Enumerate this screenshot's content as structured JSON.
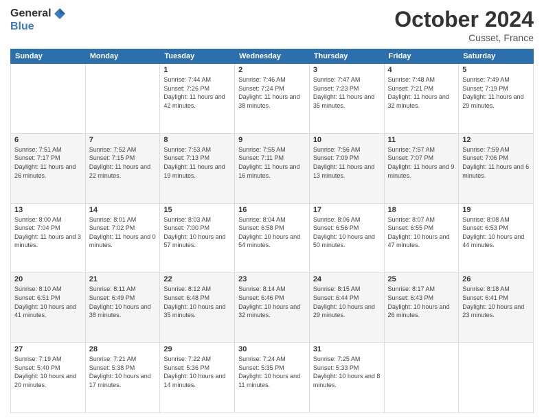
{
  "header": {
    "logo": {
      "general": "General",
      "blue": "Blue"
    },
    "month_year": "October 2024",
    "location": "Cusset, France"
  },
  "days_of_week": [
    "Sunday",
    "Monday",
    "Tuesday",
    "Wednesday",
    "Thursday",
    "Friday",
    "Saturday"
  ],
  "weeks": [
    [
      {
        "day": "",
        "info": ""
      },
      {
        "day": "",
        "info": ""
      },
      {
        "day": "1",
        "info": "Sunrise: 7:44 AM\nSunset: 7:26 PM\nDaylight: 11 hours and 42 minutes."
      },
      {
        "day": "2",
        "info": "Sunrise: 7:46 AM\nSunset: 7:24 PM\nDaylight: 11 hours and 38 minutes."
      },
      {
        "day": "3",
        "info": "Sunrise: 7:47 AM\nSunset: 7:23 PM\nDaylight: 11 hours and 35 minutes."
      },
      {
        "day": "4",
        "info": "Sunrise: 7:48 AM\nSunset: 7:21 PM\nDaylight: 11 hours and 32 minutes."
      },
      {
        "day": "5",
        "info": "Sunrise: 7:49 AM\nSunset: 7:19 PM\nDaylight: 11 hours and 29 minutes."
      }
    ],
    [
      {
        "day": "6",
        "info": "Sunrise: 7:51 AM\nSunset: 7:17 PM\nDaylight: 11 hours and 26 minutes."
      },
      {
        "day": "7",
        "info": "Sunrise: 7:52 AM\nSunset: 7:15 PM\nDaylight: 11 hours and 22 minutes."
      },
      {
        "day": "8",
        "info": "Sunrise: 7:53 AM\nSunset: 7:13 PM\nDaylight: 11 hours and 19 minutes."
      },
      {
        "day": "9",
        "info": "Sunrise: 7:55 AM\nSunset: 7:11 PM\nDaylight: 11 hours and 16 minutes."
      },
      {
        "day": "10",
        "info": "Sunrise: 7:56 AM\nSunset: 7:09 PM\nDaylight: 11 hours and 13 minutes."
      },
      {
        "day": "11",
        "info": "Sunrise: 7:57 AM\nSunset: 7:07 PM\nDaylight: 11 hours and 9 minutes."
      },
      {
        "day": "12",
        "info": "Sunrise: 7:59 AM\nSunset: 7:06 PM\nDaylight: 11 hours and 6 minutes."
      }
    ],
    [
      {
        "day": "13",
        "info": "Sunrise: 8:00 AM\nSunset: 7:04 PM\nDaylight: 11 hours and 3 minutes."
      },
      {
        "day": "14",
        "info": "Sunrise: 8:01 AM\nSunset: 7:02 PM\nDaylight: 11 hours and 0 minutes."
      },
      {
        "day": "15",
        "info": "Sunrise: 8:03 AM\nSunset: 7:00 PM\nDaylight: 10 hours and 57 minutes."
      },
      {
        "day": "16",
        "info": "Sunrise: 8:04 AM\nSunset: 6:58 PM\nDaylight: 10 hours and 54 minutes."
      },
      {
        "day": "17",
        "info": "Sunrise: 8:06 AM\nSunset: 6:56 PM\nDaylight: 10 hours and 50 minutes."
      },
      {
        "day": "18",
        "info": "Sunrise: 8:07 AM\nSunset: 6:55 PM\nDaylight: 10 hours and 47 minutes."
      },
      {
        "day": "19",
        "info": "Sunrise: 8:08 AM\nSunset: 6:53 PM\nDaylight: 10 hours and 44 minutes."
      }
    ],
    [
      {
        "day": "20",
        "info": "Sunrise: 8:10 AM\nSunset: 6:51 PM\nDaylight: 10 hours and 41 minutes."
      },
      {
        "day": "21",
        "info": "Sunrise: 8:11 AM\nSunset: 6:49 PM\nDaylight: 10 hours and 38 minutes."
      },
      {
        "day": "22",
        "info": "Sunrise: 8:12 AM\nSunset: 6:48 PM\nDaylight: 10 hours and 35 minutes."
      },
      {
        "day": "23",
        "info": "Sunrise: 8:14 AM\nSunset: 6:46 PM\nDaylight: 10 hours and 32 minutes."
      },
      {
        "day": "24",
        "info": "Sunrise: 8:15 AM\nSunset: 6:44 PM\nDaylight: 10 hours and 29 minutes."
      },
      {
        "day": "25",
        "info": "Sunrise: 8:17 AM\nSunset: 6:43 PM\nDaylight: 10 hours and 26 minutes."
      },
      {
        "day": "26",
        "info": "Sunrise: 8:18 AM\nSunset: 6:41 PM\nDaylight: 10 hours and 23 minutes."
      }
    ],
    [
      {
        "day": "27",
        "info": "Sunrise: 7:19 AM\nSunset: 5:40 PM\nDaylight: 10 hours and 20 minutes."
      },
      {
        "day": "28",
        "info": "Sunrise: 7:21 AM\nSunset: 5:38 PM\nDaylight: 10 hours and 17 minutes."
      },
      {
        "day": "29",
        "info": "Sunrise: 7:22 AM\nSunset: 5:36 PM\nDaylight: 10 hours and 14 minutes."
      },
      {
        "day": "30",
        "info": "Sunrise: 7:24 AM\nSunset: 5:35 PM\nDaylight: 10 hours and 11 minutes."
      },
      {
        "day": "31",
        "info": "Sunrise: 7:25 AM\nSunset: 5:33 PM\nDaylight: 10 hours and 8 minutes."
      },
      {
        "day": "",
        "info": ""
      },
      {
        "day": "",
        "info": ""
      }
    ]
  ]
}
